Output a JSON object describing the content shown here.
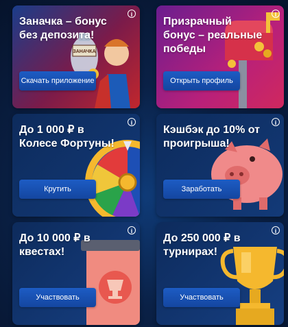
{
  "cards": [
    {
      "title": "Заначка – бонус без депозита!",
      "button": "Скачать приложение",
      "info_icon": "info-icon"
    },
    {
      "title": "Призрачный бонус – реальные победы",
      "button": "Открыть профиль",
      "info_icon": "info-icon"
    },
    {
      "title": "До 1 000 ₽ в Колесе Фортуны!",
      "button": "Крутить",
      "info_icon": "info-icon"
    },
    {
      "title": "Кэшбэк до 10% от проигрыша!",
      "button": "Заработать",
      "info_icon": "info-icon"
    },
    {
      "title": "До 10 000 ₽ в квестах!",
      "button": "Участвовать",
      "info_icon": "info-icon"
    },
    {
      "title": "До 250 000 ₽ в турнирах!",
      "button": "Участвовать",
      "info_icon": "info-icon"
    }
  ],
  "art": {
    "card1": {
      "jar_label": "ЗАНАЧКА"
    }
  },
  "colors": {
    "button": "#1d5cc4",
    "card_dark": "#0d2b5c",
    "accent_red": "#c1272d",
    "accent_purple": "#6a1d8f"
  }
}
